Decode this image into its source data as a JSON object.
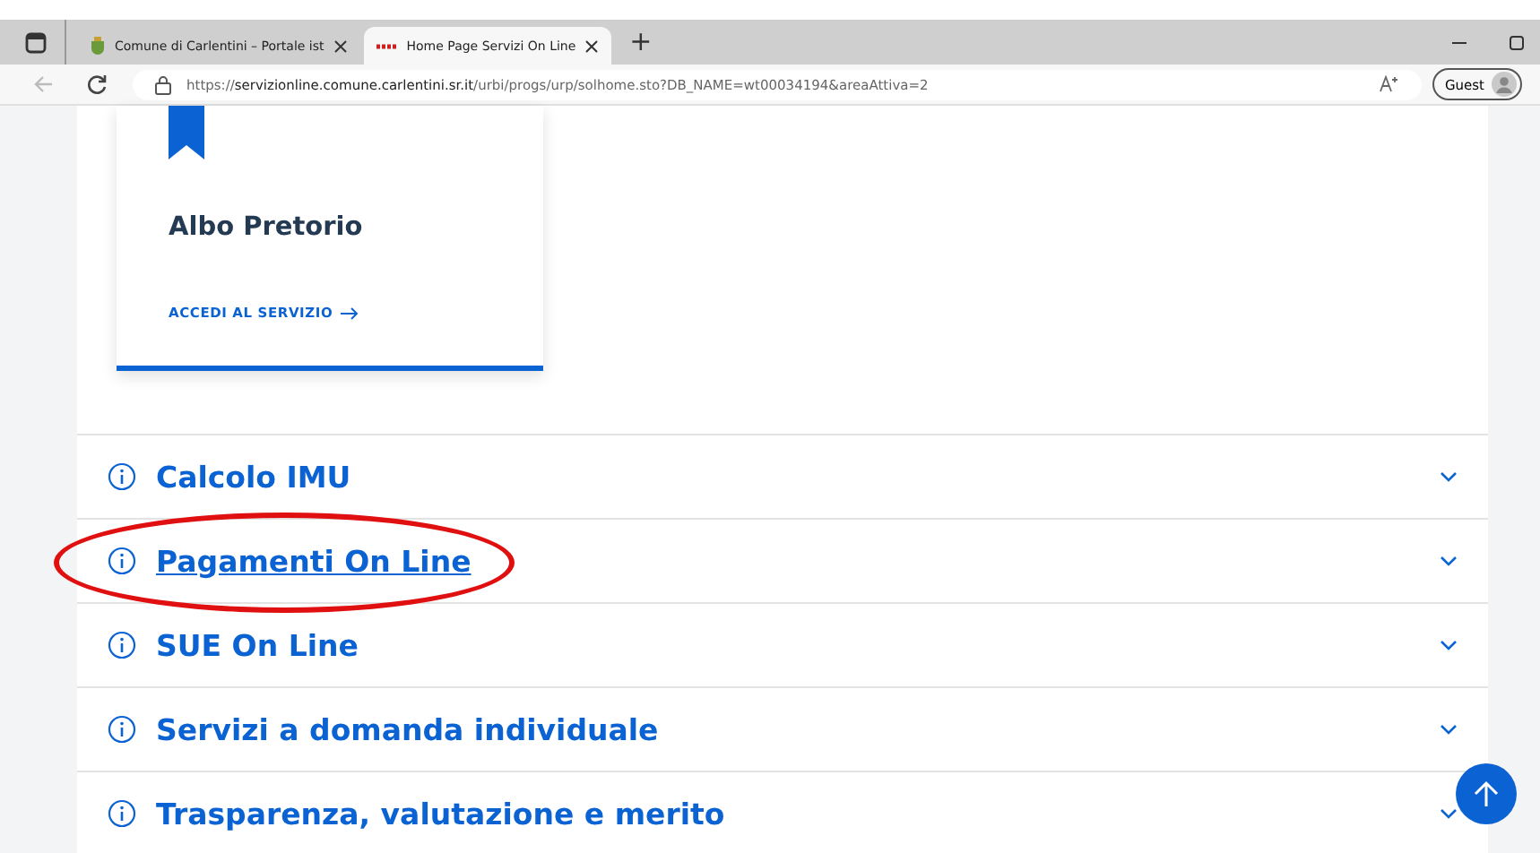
{
  "browser": {
    "tabs": [
      {
        "title": "Comune di Carlentini – Portale ist",
        "selected": false
      },
      {
        "title": "Home Page Servizi On Line",
        "selected": true
      }
    ],
    "new_tab": "+",
    "address": {
      "host": "servizionline.comune.carlentini.sr.it",
      "scheme": "https://",
      "path": "/urbi/progs/urp/solhome.sto?DB_NAME=wt00034194&areaAttiva=2"
    },
    "profile": "Guest"
  },
  "card": {
    "title": "Albo Pretorio",
    "link": "ACCEDI AL SERVIZIO"
  },
  "accordion": [
    {
      "title": "Calcolo IMU",
      "underlined": false,
      "circled": false
    },
    {
      "title": "Pagamenti On Line",
      "underlined": true,
      "circled": true
    },
    {
      "title": "SUE On Line",
      "underlined": false,
      "circled": false
    },
    {
      "title": "Servizi a domanda individuale",
      "underlined": false,
      "circled": false
    },
    {
      "title": "Trasparenza, valutazione e merito",
      "underlined": false,
      "circled": false
    }
  ]
}
